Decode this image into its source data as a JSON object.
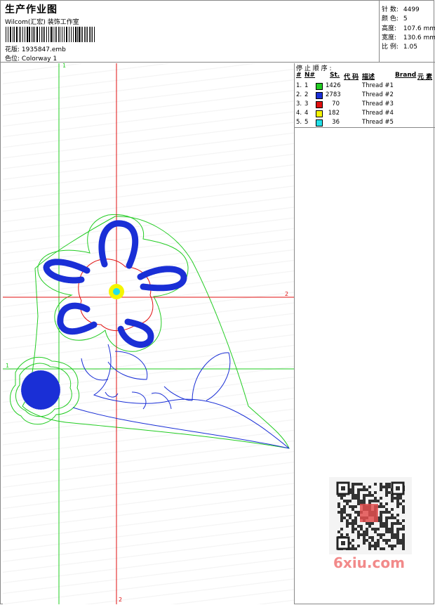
{
  "header": {
    "title": "生产作业图",
    "company": "Wilcom(汇宏) 装饰工作室",
    "design_label": "花版:",
    "design_value": "1935847.emb",
    "colorway_label": "色位:",
    "colorway_value": "Colorway 1"
  },
  "stats": [
    {
      "label": "针 数:",
      "value": "4499"
    },
    {
      "label": "颜 色:",
      "value": "5"
    },
    {
      "label": "高度:",
      "value": "107.6 mm"
    },
    {
      "label": "宽度:",
      "value": "130.6 mm"
    },
    {
      "label": "比 例:",
      "value": "1.05"
    }
  ],
  "legend": {
    "title": "停 止 顺 序 :",
    "headers": {
      "num": "#",
      "needle": "N#",
      "stitches": "St.",
      "code": "代 码",
      "desc": "描述",
      "brand": "Brand",
      "element": "元 素"
    },
    "rows": [
      {
        "num": "1.",
        "needle": "1",
        "color": "#22cc22",
        "stitches": "1426",
        "desc": "Thread #1"
      },
      {
        "num": "2.",
        "needle": "2",
        "color": "#1a2fd6",
        "stitches": "2783",
        "desc": "Thread #2"
      },
      {
        "num": "3.",
        "needle": "3",
        "color": "#e01010",
        "stitches": "70",
        "desc": "Thread #3"
      },
      {
        "num": "4.",
        "needle": "4",
        "color": "#f5f500",
        "stitches": "182",
        "desc": "Thread #4"
      },
      {
        "num": "5.",
        "needle": "5",
        "color": "#22e0e8",
        "stitches": "36",
        "desc": "Thread #5"
      }
    ]
  },
  "guides": {
    "v1_label": "1",
    "v2_label": "2",
    "h1_label": "1",
    "h2_label": "2",
    "v1_color": "#22cc22",
    "v2_color": "#e01010"
  },
  "watermark": {
    "text": "6xiu.com",
    "color": "#f28a8a"
  }
}
